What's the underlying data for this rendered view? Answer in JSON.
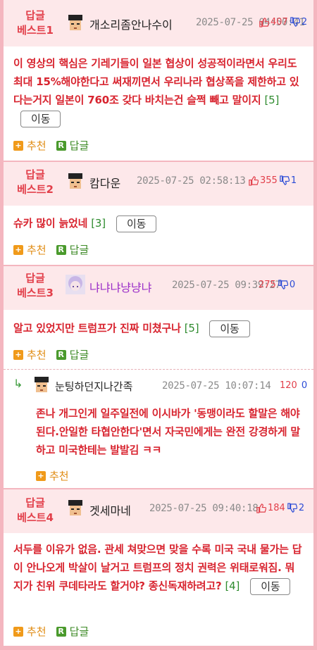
{
  "comments": [
    {
      "best_label_1": "답글",
      "best_label_2": "베스트1",
      "nickname": "개소리좀안나수이",
      "timestamp": "2025-07-25 04:50:41",
      "up": "407",
      "down": "2",
      "text": "이 영상의 핵심은 기레기들이 일본 협상이 성공적이라면서 우리도 최대 15%해야한다고 써재끼면서 우리나라 협상폭을 제한하고 있다는거지 일본이 760조 갖다 바치는건 슬쩍 빼고 말이지",
      "reply_count": "[5]",
      "move_label": "이동",
      "recommend_label": "추천",
      "reply_label": "답글"
    },
    {
      "best_label_1": "답글",
      "best_label_2": "베스트2",
      "nickname": "캄다운",
      "timestamp": "2025-07-25 02:58:13",
      "up": "355",
      "down": "1",
      "text": "슈카 많이 늙었네",
      "reply_count": "[3]",
      "move_label": "이동",
      "recommend_label": "추천",
      "reply_label": "답글"
    },
    {
      "best_label_1": "답글",
      "best_label_2": "베스트3",
      "nickname": "냐냐냐냥냥냐",
      "timestamp": "2025-07-25 09:39:27",
      "up": "275",
      "down": "0",
      "text": "알고 있었지만 트럼프가 진짜 미쳤구나",
      "reply_count": "[5]",
      "move_label": "이동",
      "recommend_label": "추천",
      "reply_label": "답글"
    },
    {
      "best_label_1": "답글",
      "best_label_2": "베스트4",
      "nickname": "겟세마네",
      "timestamp": "2025-07-25 09:40:18",
      "up": "184",
      "down": "2",
      "text": "서두를 이유가 없음. 관세 쳐맞으면 맞을 수록 미국 국내 물가는 답이 안나오게 박살이 날거고 트럼프의 정치 권력은 위태로워짐. 뭐 지가 친위 쿠데타라도 할거야? 종신독재하려고?",
      "reply_count": "[4]",
      "move_label": "이동",
      "recommend_label": "추천",
      "reply_label": "답글"
    }
  ],
  "reply": {
    "arrow": "↳",
    "nickname": "눈팅하던지나간족",
    "timestamp": "2025-07-25 10:07:14",
    "up": "120",
    "down": "0",
    "text": "존나 개그인게 일주일전에 이시바가 '동맹이라도 할말은 해야된다.안일한 타협안한다'면서 자국민에게는 완전 강경하게 말하고 미국한테는 발발김 ㅋㅋ",
    "recommend_label": "추천"
  },
  "colors": {
    "accent_red": "#e23f4a",
    "header_bg": "#fde8ea",
    "border_pink": "#f4b6bf",
    "down_blue": "#2b4bd6",
    "count_green": "#2e8b2e"
  },
  "icons": [
    "avatar-pixel-icon",
    "thumbs-up-icon",
    "thumbs-down-icon",
    "plus-square-icon",
    "r-square-icon",
    "reply-arrow-icon"
  ]
}
